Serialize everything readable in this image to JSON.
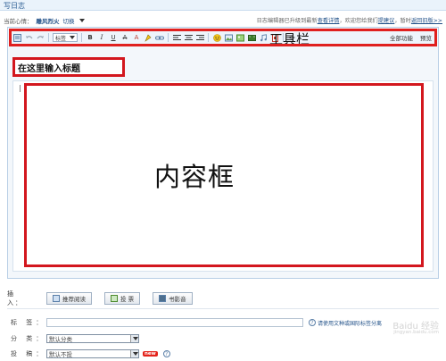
{
  "page": {
    "title": "写日志"
  },
  "mood": {
    "label": "当前心情：",
    "value": "雕风烈火",
    "switch": "切换"
  },
  "notice": {
    "text": "日志编辑器已升级到最新",
    "link1": "查看详情",
    "text2": "，欢迎您给我们",
    "link2": "提建议",
    "text3": "，暂时",
    "link3": "返回旧版>>"
  },
  "toolbar": {
    "font_select": "标签",
    "label": "工具栏",
    "full_features": "全部功能",
    "preview": "预览"
  },
  "editor": {
    "title_placeholder": "在这里输入标题",
    "content_label": "内容框"
  },
  "insert": {
    "label": "插 入：",
    "buttons": [
      "推荐阅读",
      "投 票",
      "书影音"
    ]
  },
  "form": {
    "tags_label": "标 签：",
    "tags_value": "",
    "tags_hint": "请使用文种或国际标签分离",
    "category_label": "分 类：",
    "category_value": "默认分类",
    "privacy_label": "投 稿：",
    "privacy_value": "默认不投",
    "new_badge": "new"
  },
  "watermark": {
    "text": "Baidu 经验",
    "sub": "jingyan.baidu.com"
  },
  "colors": {
    "annotation_red": "#d3171e",
    "link_blue": "#1f4f87",
    "toolbar_bg": "#eef4fb"
  }
}
